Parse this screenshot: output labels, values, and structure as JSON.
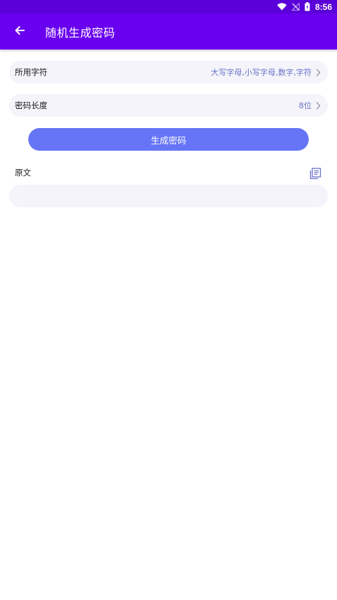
{
  "status_bar": {
    "time": "8:56",
    "icons": [
      "wifi-icon",
      "no-signal-icon",
      "battery-icon"
    ]
  },
  "app_bar": {
    "back_icon": "arrow-left-icon",
    "title": "随机生成密码",
    "background": "#6a00f0"
  },
  "charset_row": {
    "label": "所用字符",
    "value": "大写字母,小写字母,数字,字符",
    "icon": "chevron-right-icon"
  },
  "length_row": {
    "label": "密码长度",
    "value": "8位",
    "icon": "chevron-right-icon"
  },
  "generate_button": {
    "label": "生成密码",
    "color": "#6675f5"
  },
  "original": {
    "label": "原文",
    "copy_icon": "copy-icon",
    "value": ""
  },
  "colors": {
    "accent": "#6a00f0",
    "value_text": "#6a72c8",
    "row_background": "#f4f4fa"
  }
}
